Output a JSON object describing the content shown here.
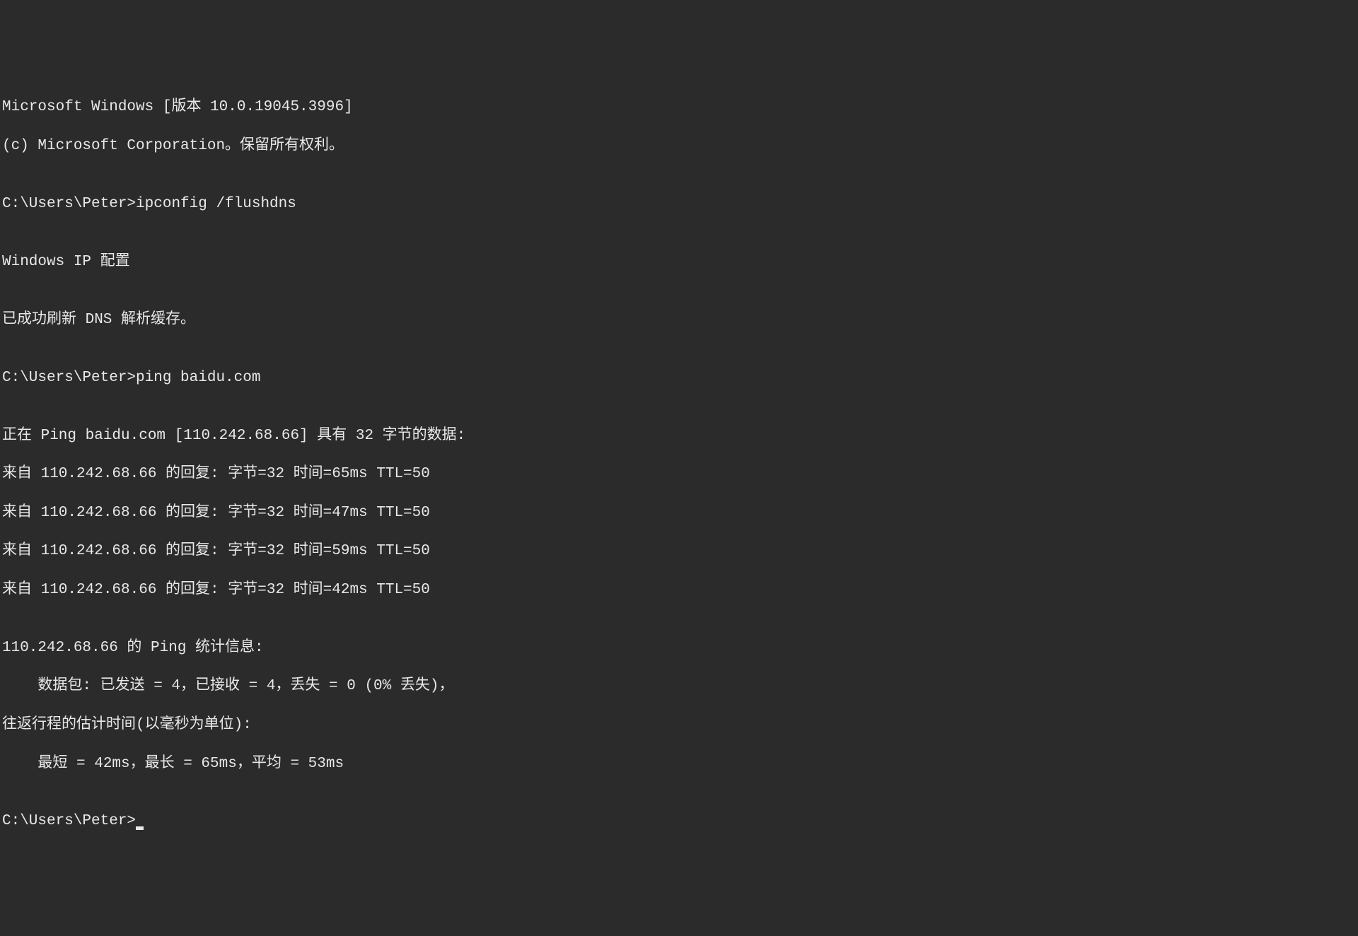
{
  "header": {
    "line1": "Microsoft Windows [版本 10.0.19045.3996]",
    "line2": "(c) Microsoft Corporation。保留所有权利。"
  },
  "blank": "",
  "prompt1": {
    "prompt": "C:\\Users\\Peter>",
    "command": "ipconfig /flushdns"
  },
  "ipconfig": {
    "header": "Windows IP 配置",
    "result": "已成功刷新 DNS 解析缓存。"
  },
  "prompt2": {
    "prompt": "C:\\Users\\Peter>",
    "command": "ping baidu.com"
  },
  "ping": {
    "header": "正在 Ping baidu.com [110.242.68.66] 具有 32 字节的数据:",
    "replies": [
      "来自 110.242.68.66 的回复: 字节=32 时间=65ms TTL=50",
      "来自 110.242.68.66 的回复: 字节=32 时间=47ms TTL=50",
      "来自 110.242.68.66 的回复: 字节=32 时间=59ms TTL=50",
      "来自 110.242.68.66 的回复: 字节=32 时间=42ms TTL=50"
    ],
    "stats_header": "110.242.68.66 的 Ping 统计信息:",
    "stats_packets": "    数据包: 已发送 = 4，已接收 = 4，丢失 = 0 (0% 丢失)，",
    "rtt_header": "往返行程的估计时间(以毫秒为单位):",
    "rtt_values": "    最短 = 42ms，最长 = 65ms，平均 = 53ms"
  },
  "prompt3": {
    "prompt": "C:\\Users\\Peter>"
  }
}
